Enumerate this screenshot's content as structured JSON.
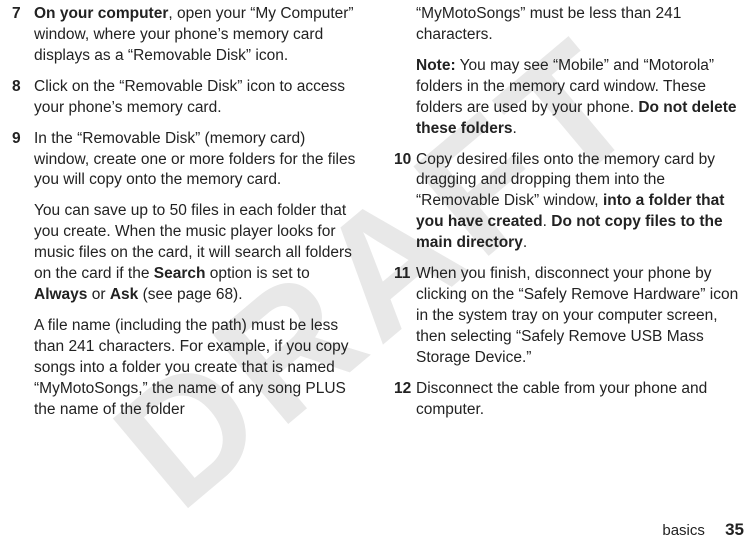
{
  "watermark": "DRAFT",
  "left": {
    "step7": {
      "num": "7",
      "lead": "On your computer",
      "tail": ", open your “My Computer” window, where your phone’s memory card displays as a “Removable Disk” icon."
    },
    "step8": {
      "num": "8",
      "text": "Click on the “Removable Disk” icon to access your phone’s memory card."
    },
    "step9": {
      "num": "9",
      "p1": "In the “Removable Disk” (memory card) window, create one or more folders for the files you will copy onto the memory card.",
      "p2a": "You can save up to 50 files in each folder that you create. When the music player looks for music files on the card, it will search all folders on the card if the ",
      "p2b": "Search",
      "p2c": " option is set to ",
      "p2d": "Always",
      "p2e": " or ",
      "p2f": "Ask",
      "p2g": " (see page 68).",
      "p3": "A file name (including the path) must be less than 241 characters. For example, if you copy songs into a folder you create that is named “MyMotoSongs,” the name of any song PLUS the name of the folder"
    }
  },
  "right": {
    "cont": {
      "p1": "“MyMotoSongs” must be less than 241 characters.",
      "p2a": "Note:",
      "p2b": " You may see “Mobile” and “Motorola” folders in the memory card window. These folders are used by your phone. ",
      "p2c": "Do not delete these folders",
      "p2d": "."
    },
    "step10": {
      "num": "10",
      "a": "Copy desired files onto the memory card by dragging and dropping them into the “Removable Disk” window, ",
      "b": "into a folder that you have created",
      "c": ". ",
      "d": "Do not copy files to the main directory",
      "e": "."
    },
    "step11": {
      "num": "11",
      "text": "When you finish, disconnect your phone by clicking on the “Safely Remove Hardware” icon in the system tray on your computer screen, then selecting “Safely Remove USB Mass Storage Device.”"
    },
    "step12": {
      "num": "12",
      "text": "Disconnect the cable from your phone and computer."
    }
  },
  "footer": {
    "section": "basics",
    "page": "35"
  }
}
